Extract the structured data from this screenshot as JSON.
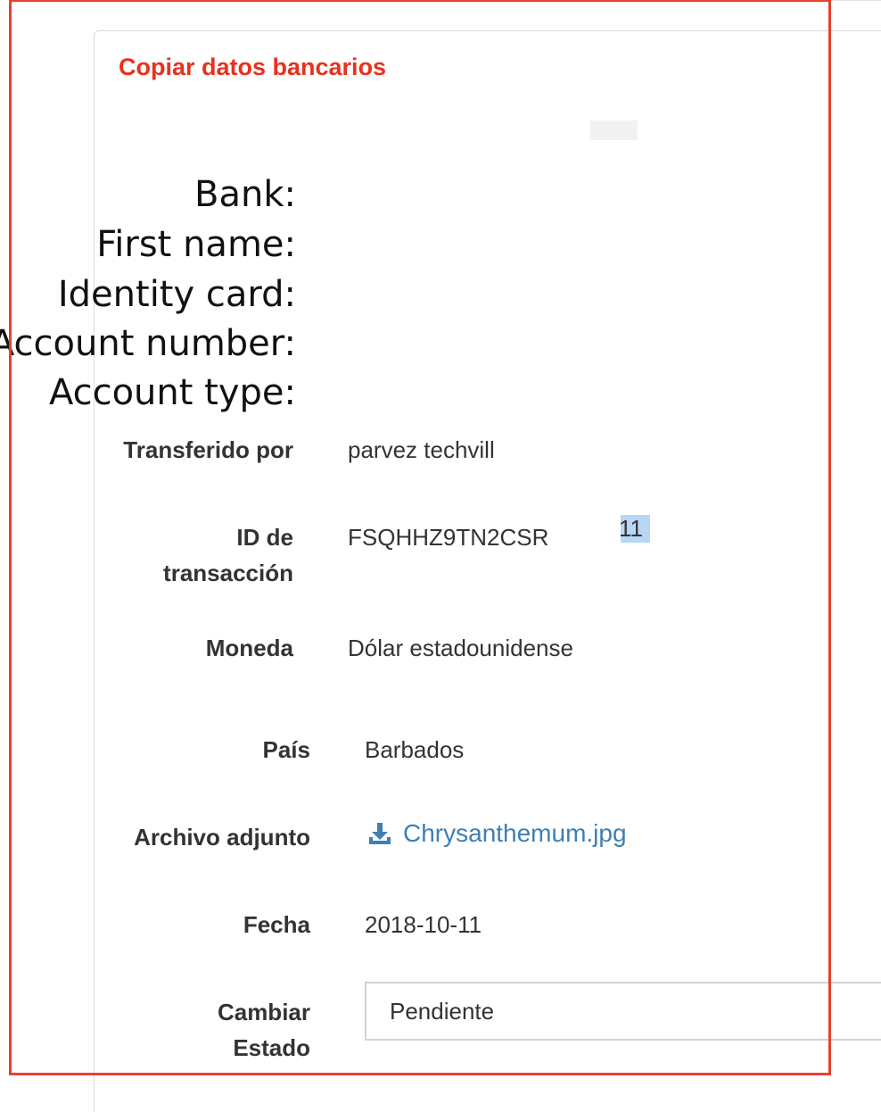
{
  "panel": {
    "copy_link": "Copiar datos bancarios"
  },
  "bank_details": {
    "bank_label": "Bank:",
    "first_name_label": "First name:",
    "identity_card_label": "Identity card:",
    "account_number_label": "Account number:",
    "account_type_label": "Account type:"
  },
  "details": {
    "transferred_by": {
      "label": "Transferido por",
      "value": "parvez techvill"
    },
    "transaction_id": {
      "label_line1": "ID de",
      "label_line2": "transacción",
      "value": "FSQHHZ9TN2CSR",
      "highlighted_fragment": "11"
    },
    "currency": {
      "label": "Moneda",
      "value": "Dólar estadounidense"
    },
    "country": {
      "label": "País",
      "value": "Barbados"
    },
    "attachment": {
      "label": "Archivo adjunto",
      "file_name": "Chrysanthemum.jpg",
      "icon": "download-icon"
    },
    "date": {
      "label": "Fecha",
      "value": "2018-10-11"
    },
    "change_status": {
      "label_line1": "Cambiar",
      "label_line2": "Estado",
      "selected": "Pendiente"
    }
  },
  "colors": {
    "link_red": "#e8311f",
    "link_blue": "#3f7fb2",
    "frame_red": "#e8412c",
    "selection": "#b8d6f5"
  }
}
